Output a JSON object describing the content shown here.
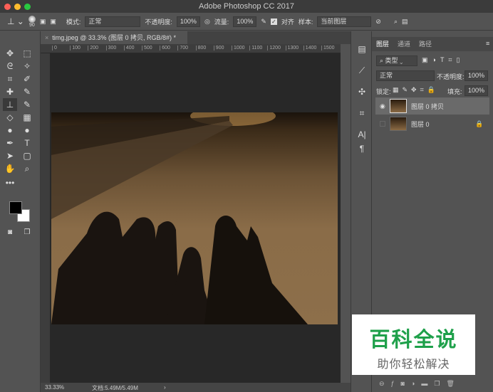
{
  "window": {
    "title": "Adobe Photoshop CC 2017"
  },
  "options": {
    "brush_size": "90",
    "mode_label": "模式:",
    "mode_value": "正常",
    "opacity_label": "不透明度:",
    "opacity_value": "100%",
    "flow_label": "流量:",
    "flow_value": "100%",
    "align_label": "对齐",
    "align_checked": true,
    "sample_label": "样本:",
    "sample_value": "当前图层"
  },
  "document": {
    "tab_label": "timg.jpeg @ 33.3% (图层 0 拷贝, RGB/8#) *",
    "ruler_ticks": [
      "0",
      "100",
      "200",
      "300",
      "400",
      "500",
      "600",
      "700",
      "800",
      "900",
      "1000",
      "1100",
      "1200",
      "1300",
      "1400",
      "1500"
    ]
  },
  "status": {
    "zoom": "33.33%",
    "doc_info": "文档:5.49M/5.49M"
  },
  "panel": {
    "tabs": [
      "图层",
      "通道",
      "路径"
    ],
    "filter_label": "类型",
    "blend_mode": "正常",
    "opacity_label": "不透明度:",
    "opacity_value": "100%",
    "lock_label": "锁定:",
    "fill_label": "填充:",
    "fill_value": "100%",
    "layers": [
      {
        "name": "图层 0 拷贝",
        "visible": true,
        "selected": true,
        "locked": false
      },
      {
        "name": "图层 0",
        "visible": false,
        "selected": false,
        "locked": true
      }
    ]
  },
  "watermark": {
    "title": "百科全说",
    "subtitle": "助你轻松解决"
  },
  "colors": {
    "foreground": "#000000",
    "background": "#ffffff"
  }
}
